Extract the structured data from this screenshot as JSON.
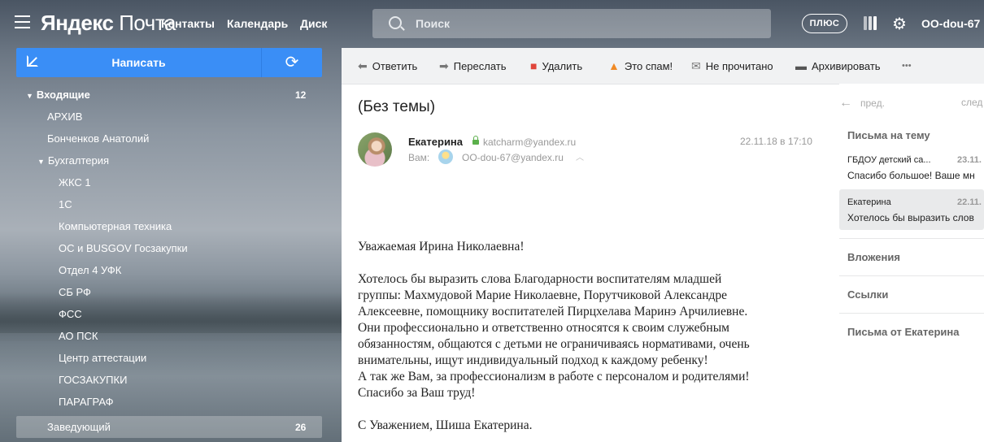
{
  "header": {
    "logo_brand": "Яндекс",
    "logo_product": "Почта",
    "nav": [
      "Контакты",
      "Календарь",
      "Диск"
    ],
    "search_placeholder": "Поиск",
    "plus_label": "ПЛЮС",
    "user": "OO-dou-67"
  },
  "compose": {
    "label": "Написать"
  },
  "folders": {
    "inbox": {
      "label": "Входящие",
      "count": "12"
    },
    "items": [
      "АРХИВ",
      "Бонченков Анатолий",
      "Бухгалтерия",
      "ЖКС 1",
      "1С",
      "Компьютерная техника",
      "ОС и BUSGOV Госзакупки",
      "Отдел 4 УФК",
      "СБ РФ",
      "ФСС",
      "АО ПСК",
      "Центр аттестации",
      "ГОСЗАКУПКИ",
      "ПАРАГРАФ"
    ],
    "selected": {
      "label": "Заведующий",
      "count": "26"
    }
  },
  "toolbar": {
    "reply": "Ответить",
    "forward": "Переслать",
    "delete": "Удалить",
    "spam": "Это спам!",
    "unread": "Не прочитано",
    "archive": "Архивировать",
    "more": "•••"
  },
  "message": {
    "subject": "(Без темы)",
    "sender_name": "Екатерина",
    "sender_email": "katcharm@yandex.ru",
    "date": "22.11.18 в 17:10",
    "to_label": "Вам:",
    "to_email": "OO-dou-67@yandex.ru",
    "body": {
      "greeting": "Уважаемая Ирина Николаевна!",
      "lines": [
        "Хотелось бы выразить слова Благодарности воспитателям младшей",
        "группы: Махмудовой Марие Николаевне, Порутчиковой Александре",
        "Алексеевне, помощнику воспитателей Пирцхелава Маринэ Арчилиевне.",
        "Они профессионально и ответственно относятся к своим служебным",
        "обязанностям, общаются с детьми не ограничиваясь нормативами, очень",
        "внимательны, ищут индивидуальный подход к каждому ребенку!",
        "А так же Вам, за профессионализм в работе с персоналом и родителями!",
        "Спасибо за Ваш труд!"
      ],
      "signoff": "С Уважением, Шиша Екатерина."
    }
  },
  "sidebar": {
    "prev": "пред.",
    "next": "след",
    "thread_header": "Письма на тему",
    "threads": [
      {
        "from": "ГБДОУ детский са...",
        "date": "23.11.",
        "text": "Спасибо большое! Ваше мн"
      },
      {
        "from": "Екатерина",
        "date": "22.11.",
        "text": "Хотелось бы выразить слов"
      }
    ],
    "attachments": "Вложения",
    "links": "Ссылки",
    "from_sender": "Письма от Екатерина"
  }
}
